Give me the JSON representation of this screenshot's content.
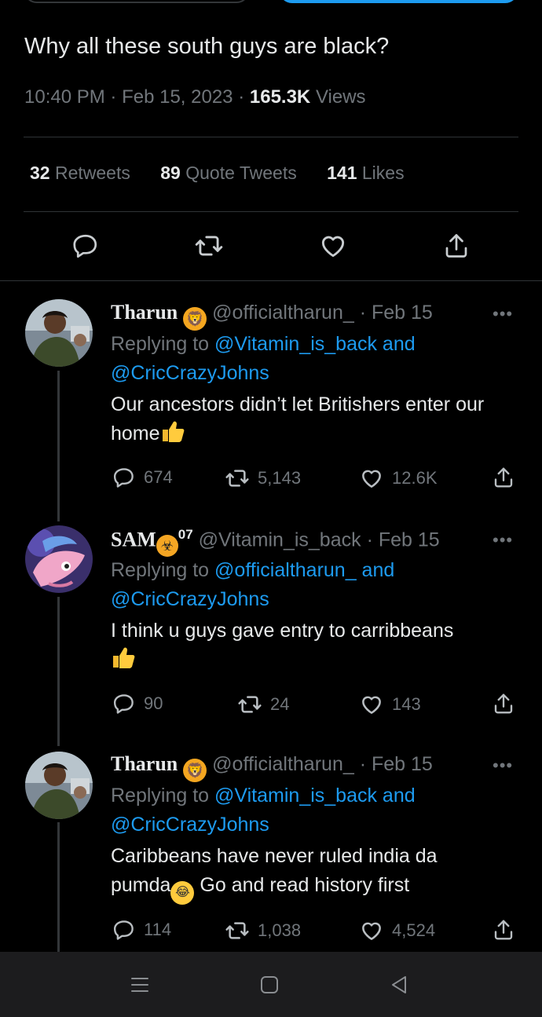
{
  "tweet": {
    "text": "Why all these south guys are black?",
    "time": "10:40 PM",
    "date": "Feb 15, 2023",
    "views_count": "165.3K",
    "views_label": "Views"
  },
  "stats": {
    "retweets_count": "32",
    "retweets_label": "Retweets",
    "quotes_count": "89",
    "quotes_label": "Quote Tweets",
    "likes_count": "141",
    "likes_label": "Likes"
  },
  "replies": [
    {
      "name": "Tharun",
      "handle": "@officialtharun_",
      "date": "· Feb 15",
      "replying_prefix": "Replying to",
      "replying_to_1": "@Vitamin_is_back and",
      "replying_to_2": "@CricCrazyJohns",
      "body": "Our ancestors didn’t let Britishers enter our home",
      "reply_count": "674",
      "retweet_count": "5,143",
      "like_count": "12.6K"
    },
    {
      "name": "SAM",
      "name_suffix": "07",
      "handle": "@Vitamin_is_back",
      "date": "· Feb 15",
      "replying_prefix": "Replying to",
      "replying_to_1": "@officialtharun_ and",
      "replying_to_2": "@CricCrazyJohns",
      "body": "I think u guys gave entry to carribbeans",
      "reply_count": "90",
      "retweet_count": "24",
      "like_count": "143"
    },
    {
      "name": "Tharun",
      "handle": "@officialtharun_",
      "date": "· Feb 15",
      "replying_prefix": "Replying to",
      "replying_to_1": "@Vitamin_is_back and",
      "replying_to_2": "@CricCrazyJohns",
      "body_1": "Caribbeans have never ruled india da",
      "body_2a": "pumda",
      "body_2b": " Go and read history first",
      "reply_count": "114",
      "retweet_count": "1,038",
      "like_count": "4,524"
    }
  ],
  "icons": {
    "reply": "reply-icon",
    "retweet": "retweet-icon",
    "like": "heart-icon",
    "share": "share-icon",
    "more": "more-icon"
  },
  "colors": {
    "background": "#000000",
    "text": "#e7e9ea",
    "secondary": "#71767b",
    "link": "#1d9bf0",
    "divider": "#2f3336"
  },
  "more_glyph": "•••"
}
